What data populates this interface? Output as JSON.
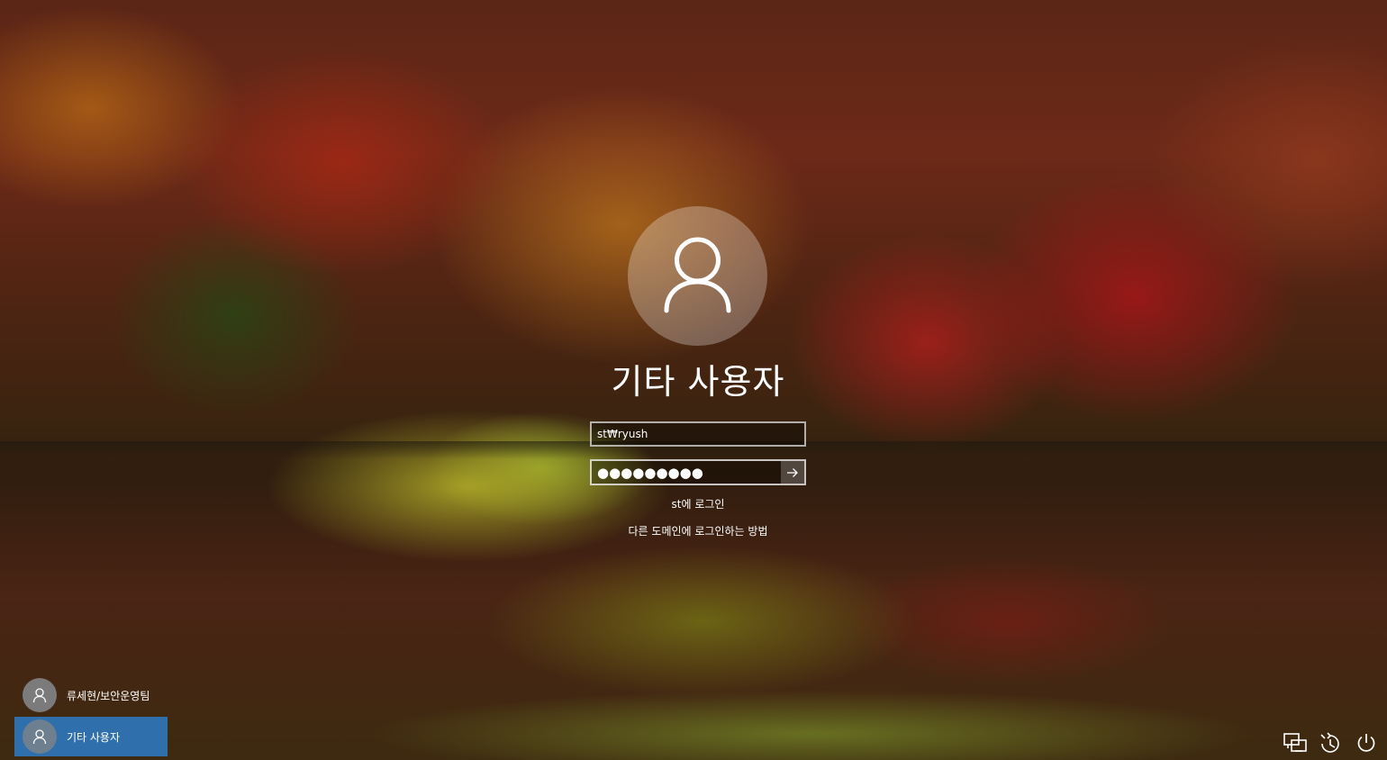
{
  "login": {
    "user_display_name": "기타 사용자",
    "username_value": "st₩ryush",
    "password_masked": "●●●●●●●●●",
    "signin_to_text": "st에 로그인",
    "other_domain_link": "다른 도메인에 로그인하는 방법"
  },
  "user_list": [
    {
      "label": "류세현/보안운영팀",
      "selected": false
    },
    {
      "label": "기타 사용자",
      "selected": true
    }
  ],
  "tray": {
    "network_icon": "network-icon",
    "accessibility_icon": "ease-of-access-icon",
    "power_icon": "power-icon"
  },
  "colors": {
    "selected_tile": "#2d7dc8",
    "field_border": "#ffffff"
  }
}
